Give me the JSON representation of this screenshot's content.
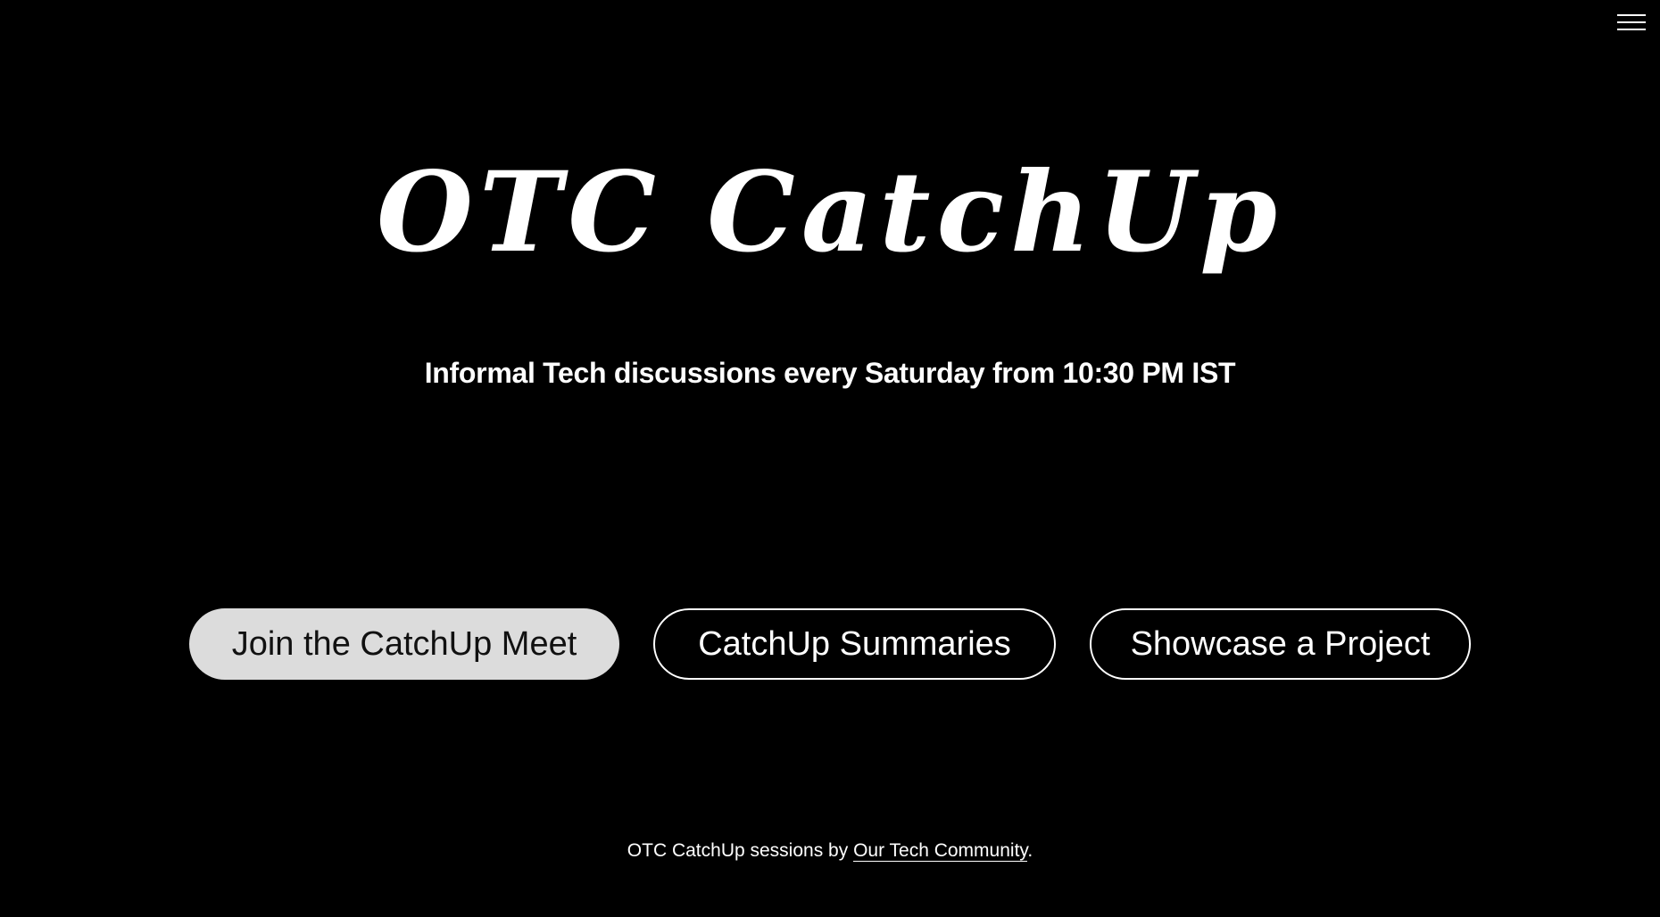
{
  "header": {
    "menu_icon": "hamburger-menu-icon"
  },
  "hero": {
    "title": "OTC CatchUp",
    "tagline": "Informal Tech discussions every Saturday from 10:30 PM IST"
  },
  "actions": [
    {
      "label": "Join the CatchUp Meet"
    },
    {
      "label": "CatchUp Summaries"
    },
    {
      "label": "Showcase a Project"
    }
  ],
  "footer": {
    "prefix": "OTC CatchUp sessions by ",
    "link_text": "Our Tech Community",
    "suffix": "."
  },
  "colors": {
    "background": "#000000",
    "text": "#ffffff",
    "primary_button_bg": "#dcdcdc",
    "primary_button_text": "#111111"
  }
}
